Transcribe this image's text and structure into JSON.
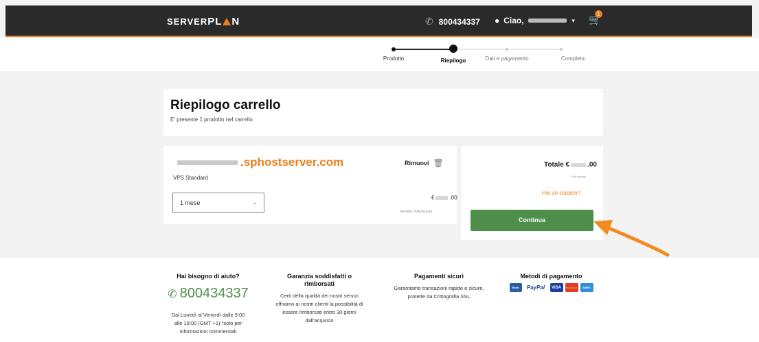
{
  "header": {
    "logo_left": "SERVER",
    "logo_right": "PL",
    "logo_end": "N",
    "phone": "800434337",
    "greeting": "Ciao,",
    "cart_count": "1"
  },
  "steps": [
    {
      "label": "Prodotto",
      "state": "done"
    },
    {
      "label": "Riepilogo",
      "state": "active"
    },
    {
      "label": "Dati e pagamento",
      "state": "future"
    },
    {
      "label": "Completa",
      "state": "future"
    }
  ],
  "summary": {
    "title": "Riepilogo carrello",
    "subtitle": "E' presente 1 prodotto nel carrello"
  },
  "cart_item": {
    "domain_suffix": ".sphostserver.com",
    "product": "VPS Standard",
    "billing_select": "1 mese",
    "remove_label": "Rimuovi",
    "price_prefix": "€",
    "price_suffix": ".00",
    "price_note": "mensile / IVA esclusa"
  },
  "totals": {
    "label": "Totale €",
    "suffix": ".00",
    "vat_note": "IVA Inclusa",
    "coupon_link": "Hai un coupon?",
    "continue_label": "Continua"
  },
  "footer": {
    "help_title": "Hai bisogno di aiuto?",
    "help_phone": "800434337",
    "help_text": "Dal Lunedì al Venerdì dalle 9:00 alle 18:00 (GMT +1) *solo per informazioni commerciali",
    "guarantee_title": "Garanzia soddisfatti o rimborsati",
    "guarantee_text": "Certi della qualità dei nostri servizi offriamo ai nostri clienti la possibilità di essere rimborsati entro 30 giorni dall'acquisto",
    "secure_title": "Pagamenti sicuri",
    "secure_text": "Garantiamo transazioni rapide e sicure, protette da Crittografia SSL",
    "methods_title": "Metodi di pagamento",
    "methods": [
      "Bank",
      "PayPal",
      "VISA",
      "MasterCard",
      "AMEX"
    ]
  },
  "colors": {
    "accent": "#f07d1a",
    "primary_button": "#4d8f4a",
    "header_bg": "#2a2a2a"
  }
}
